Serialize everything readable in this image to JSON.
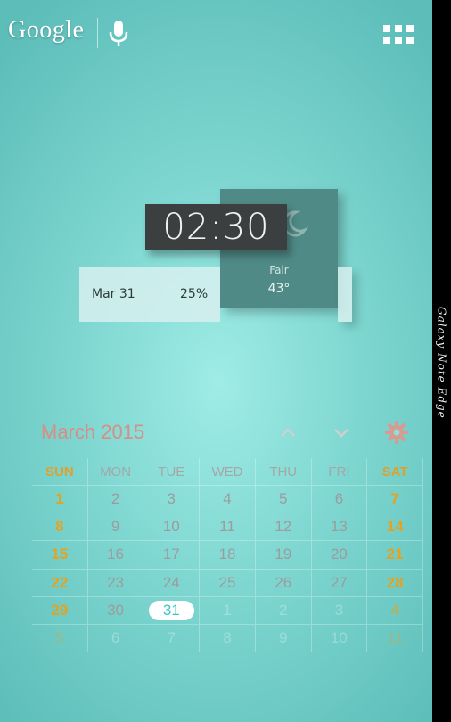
{
  "status_bar": {
    "google_label": "Google",
    "mic_icon": "mic-icon",
    "apps_icon": "apps-grid-icon"
  },
  "edge_panel": {
    "label": "Galaxy Note Edge"
  },
  "widget": {
    "time": "02:30",
    "weather_condition": "Fair",
    "temperature": "43°",
    "date": "Mar 31",
    "battery": "25%",
    "weather_icon": "moon-icon"
  },
  "calendar": {
    "title": "March 2015",
    "prev_icon": "chevron-up-icon",
    "next_icon": "chevron-down-icon",
    "settings_icon": "gear-icon",
    "weekdays": [
      "SUN",
      "MON",
      "TUE",
      "WED",
      "THU",
      "FRI",
      "SAT"
    ],
    "weeks": [
      [
        "1",
        "2",
        "3",
        "4",
        "5",
        "6",
        "7"
      ],
      [
        "8",
        "9",
        "10",
        "11",
        "12",
        "13",
        "14"
      ],
      [
        "15",
        "16",
        "17",
        "18",
        "19",
        "20",
        "21"
      ],
      [
        "22",
        "23",
        "24",
        "25",
        "26",
        "27",
        "28"
      ],
      [
        "29",
        "30",
        "31",
        "1",
        "2",
        "3",
        "4"
      ],
      [
        "5",
        "6",
        "7",
        "8",
        "9",
        "10",
        "11"
      ]
    ],
    "today": "31",
    "accent_color": "#e6a21f",
    "today_color": "#3cc7c2"
  }
}
